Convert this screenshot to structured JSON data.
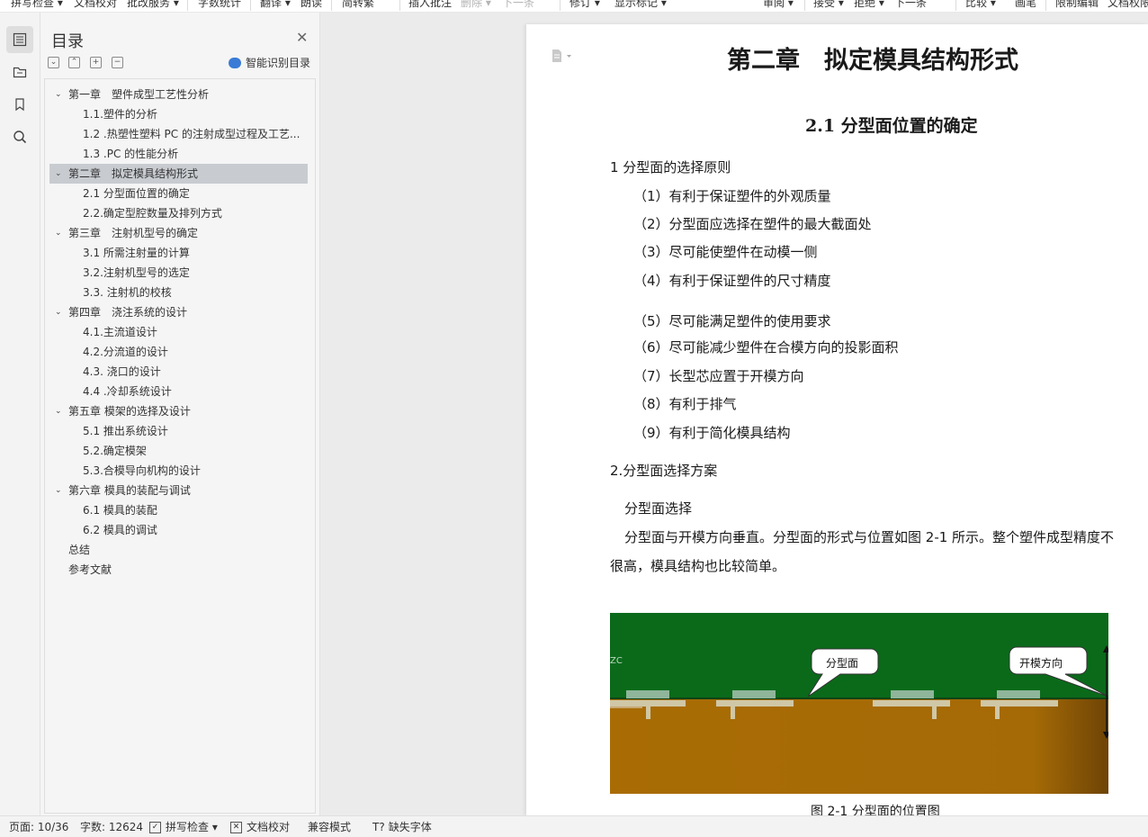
{
  "toolbar": {
    "items": [
      "拼写检查",
      "文档校对",
      "批改服务",
      "字数统计",
      "翻译",
      "朗读",
      "简转繁",
      "插入批注",
      "删除",
      "下一条",
      "修订",
      "显示标记",
      "审阅",
      "接受",
      "拒绝",
      "下一条",
      "比较",
      "画笔",
      "限制编辑",
      "文档权限"
    ]
  },
  "toc": {
    "title": "目录",
    "smart_label": "智能识别目录",
    "items": [
      {
        "label": "第一章　塑件成型工艺性分析",
        "level": 1,
        "expanded": true
      },
      {
        "label": "1.1.塑件的分析",
        "level": 2
      },
      {
        "label": "1.2 .热塑性塑料 PC 的注射成型过程及工艺...",
        "level": 2
      },
      {
        "label": "1.3 .PC 的性能分析",
        "level": 2
      },
      {
        "label": "第二章　拟定模具结构形式",
        "level": 1,
        "expanded": true,
        "selected": true
      },
      {
        "label": "2.1 分型面位置的确定",
        "level": 2
      },
      {
        "label": "2.2.确定型腔数量及排列方式",
        "level": 2
      },
      {
        "label": "第三章　注射机型号的确定",
        "level": 1,
        "expanded": true
      },
      {
        "label": "3.1 所需注射量的计算",
        "level": 2
      },
      {
        "label": "3.2.注射机型号的选定",
        "level": 2
      },
      {
        "label": "3.3. 注射机的校核",
        "level": 2
      },
      {
        "label": "第四章　浇注系统的设计",
        "level": 1,
        "expanded": true
      },
      {
        "label": "4.1.主流道设计",
        "level": 2
      },
      {
        "label": "4.2.分流道的设计",
        "level": 2
      },
      {
        "label": "4.3. 浇口的设计",
        "level": 2
      },
      {
        "label": "4.4 .冷却系统设计",
        "level": 2
      },
      {
        "label": "第五章 模架的选择及设计",
        "level": 1,
        "expanded": true
      },
      {
        "label": "5.1  推出系统设计",
        "level": 2
      },
      {
        "label": "5.2.确定模架",
        "level": 2
      },
      {
        "label": "5.3.合模导向机构的设计",
        "level": 2
      },
      {
        "label": "第六章  模具的装配与调试",
        "level": 1,
        "expanded": true
      },
      {
        "label": "6.1  模具的装配",
        "level": 2
      },
      {
        "label": "6.2  模具的调试",
        "level": 2
      },
      {
        "label": "总结",
        "level": 0
      },
      {
        "label": "参考文献",
        "level": 0
      }
    ]
  },
  "document": {
    "chapter_title": "第二章　拟定模具结构形式",
    "section_title": "2.1 分型面位置的确定",
    "heading1": "1 分型面的选择原则",
    "principles": [
      "（1）有利于保证塑件的外观质量",
      "（2）分型面应选择在塑件的最大截面处",
      "（3）尽可能使塑件在动模一侧",
      "（4）有利于保证塑件的尺寸精度",
      "（5）尽可能满足塑件的使用要求",
      "（6）尽可能减少塑件在合模方向的投影面积",
      "（7）长型芯应置于开模方向",
      "（8）有利于排气",
      "（9）有利于简化模具结构"
    ],
    "heading2": "2.分型面选择方案",
    "sub_heading": "分型面选择",
    "body_line1": "分型面与开模方向垂直。分型面的形式与位置如图 2-1 所示。整个塑件成型精度不",
    "body_line2": "很高，模具结构也比较简单。",
    "figure_callout1": "分型面",
    "figure_callout2": "开模方向",
    "figure_small_text": "ZC",
    "figure_caption": "图 2-1 分型面的位置图"
  },
  "status": {
    "page": "页面: 10/36",
    "words": "字数: 12624",
    "spell_check": "拼写检查",
    "doc_check": "文档校对",
    "compat": "兼容模式",
    "missing_font": "缺失字体"
  },
  "colors": {
    "figure_green": "#0a6a1a",
    "figure_brown": "#a86a06",
    "toc_selected": "#c8ccd1",
    "smart_icon": "#3a7bd5"
  }
}
